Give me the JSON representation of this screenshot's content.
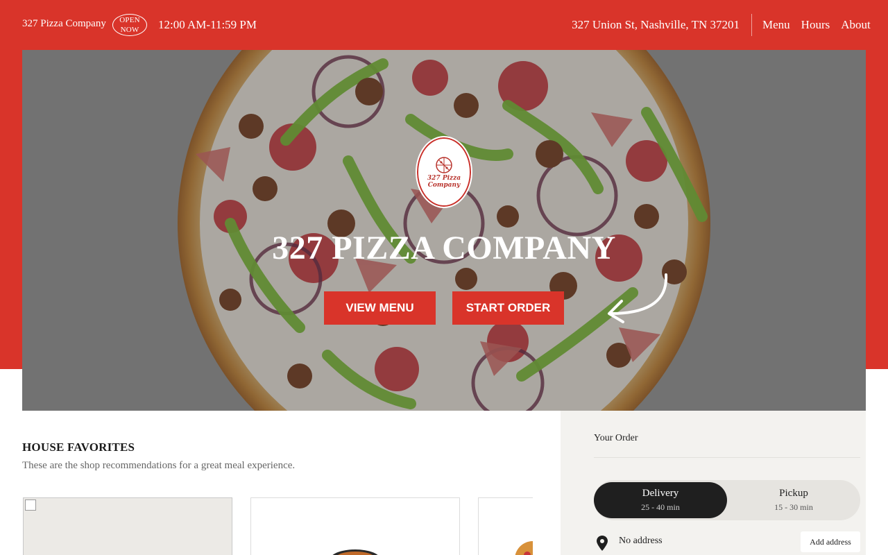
{
  "header": {
    "brand": "327 Pizza Company",
    "open_badge": [
      "OPEN",
      "NOW"
    ],
    "hours": "12:00 AM-11:59 PM",
    "address": "327 Union St, Nashville, TN 37201",
    "nav": [
      "Menu",
      "Hours",
      "About"
    ]
  },
  "hero": {
    "logo_text": "327 Pizza Company",
    "title": "327 PIZZA COMPANY",
    "buttons": {
      "view_menu": "VIEW MENU",
      "start_order": "START ORDER"
    }
  },
  "favorites": {
    "title": "HOUSE FAVORITES",
    "subtitle": "These are the shop recommendations for a great meal experience."
  },
  "order": {
    "title": "Your Order",
    "delivery": {
      "label": "Delivery",
      "time": "25 - 40 min"
    },
    "pickup": {
      "label": "Pickup",
      "time": "15 - 30 min"
    },
    "address_status": "No address",
    "add_address": "Add address"
  },
  "colors": {
    "brand_red": "#d9342a",
    "toggle_active": "#1f1f1f",
    "panel_bg": "#f3f2ef"
  }
}
